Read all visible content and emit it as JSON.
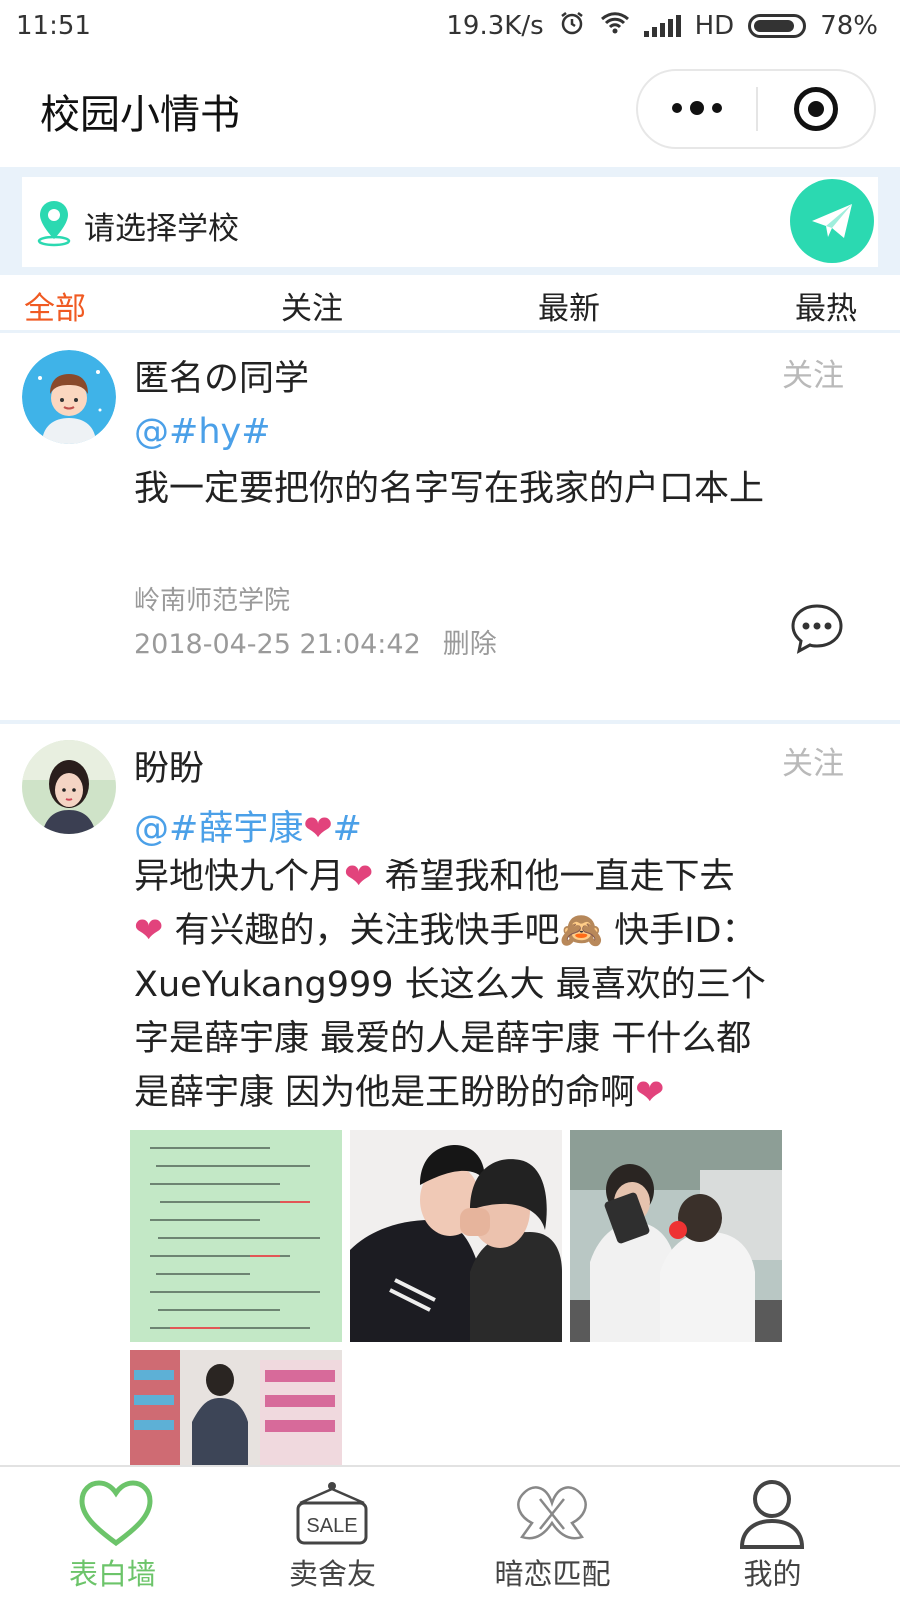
{
  "status_bar": {
    "time": "11:51",
    "speed": "19.3K/s",
    "network": "HD",
    "battery": "78%"
  },
  "title_bar": {
    "title": "校园小情书"
  },
  "search": {
    "placeholder": "请选择学校"
  },
  "tabs": [
    {
      "label": "全部",
      "active": true
    },
    {
      "label": "关注"
    },
    {
      "label": "最新"
    },
    {
      "label": "最热"
    }
  ],
  "posts": [
    {
      "username": "匿名の同学",
      "follow_label": "关注",
      "mention": "@#hy#",
      "content": "我一定要把你的名字写在我家的户口本上",
      "school": "岭南师范学院",
      "timestamp": "2018-04-25 21:04:42",
      "delete_label": "删除"
    },
    {
      "username": "盼盼",
      "username_emoji": "",
      "follow_label": "关注",
      "mention": "@#薛宇康",
      "mention_end": "#",
      "content_lines": [
        "异地快九个月",
        " 希望我和他一直走下去",
        " 有兴趣的，关注我快手吧",
        " 快手ID：",
        "XueYukang999 长这么大 最喜欢的三个",
        "字是薛宇康 最爱的人是薛宇康 干什么都",
        "是薛宇康 因为他是王盼盼的命啊"
      ],
      "emoji_heart": "❤",
      "emoji_monkey": "🙈"
    }
  ],
  "bottom_nav": [
    {
      "label": "表白墙",
      "icon": "heart-icon",
      "active": true
    },
    {
      "label": "卖舍友",
      "icon": "sale-tag-icon",
      "sale_text": "SALE"
    },
    {
      "label": "暗恋匹配",
      "icon": "ribbon-icon"
    },
    {
      "label": "我的",
      "icon": "person-icon"
    }
  ],
  "colors": {
    "accent_tab": "#f05a22",
    "send": "#2bd9b1",
    "mention": "#4ba0e8",
    "nav_active": "#6cc46a",
    "heart": "#e2437c"
  }
}
